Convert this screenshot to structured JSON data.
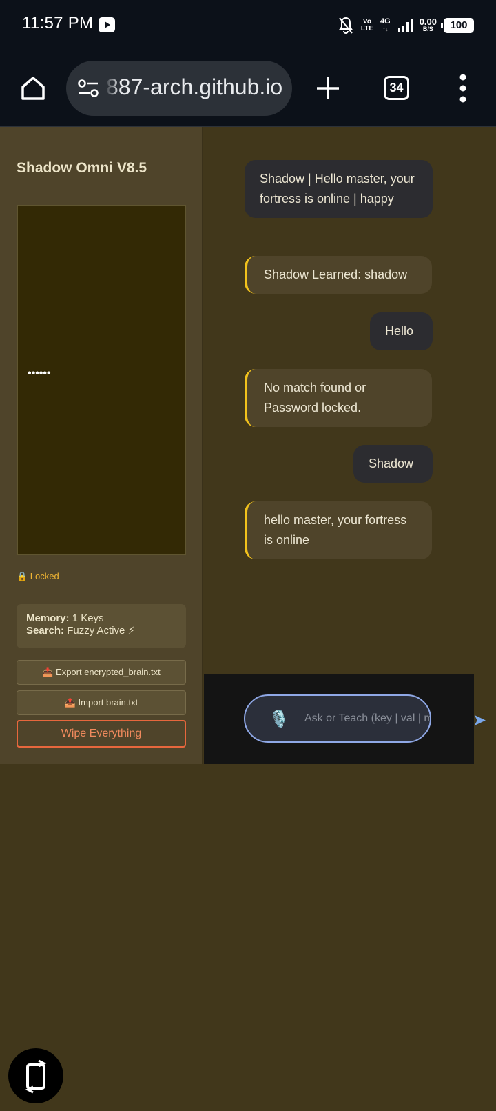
{
  "status_bar": {
    "time": "11:57 PM",
    "volte_top": "Vo",
    "volte_bottom": "LTE",
    "network": "4G",
    "network_sub": "↑↓",
    "speed": "0.00",
    "speed_unit": "B/S",
    "battery": "100"
  },
  "browser": {
    "url": "887-arch.github.io",
    "tab_count": "34"
  },
  "sidebar": {
    "title": "Shadow Omni V8.5",
    "password_dots": "••••••",
    "lock_status": "🔒 Locked",
    "memory_label": "Memory:",
    "memory_value": " 1 Keys",
    "search_label": "Search:",
    "search_value": " Fuzzy Active ⚡",
    "export_label": "📥 Export encrypted_brain.txt",
    "import_label": "📤 Import brain.txt",
    "wipe_label": "Wipe Everything"
  },
  "chat": {
    "messages": [
      {
        "type": "bot",
        "text": "Shadow | Hello master, your fortress is online | happy"
      },
      {
        "type": "note",
        "text": "Shadow Learned: shadow"
      },
      {
        "type": "user",
        "text": "Hello"
      },
      {
        "type": "note",
        "text": "No match found or Password locked."
      },
      {
        "type": "user",
        "text": "Shadow"
      },
      {
        "type": "note",
        "text": "hello master, your fortress is online"
      }
    ]
  },
  "input": {
    "mic_icon": "🎙️",
    "placeholder": "Ask or Teach (key | val | mood)...",
    "send_icon": "➤"
  },
  "icons": {
    "home": "home-icon",
    "tune": "site-settings-icon",
    "plus": "new-tab-icon",
    "menu": "more-vert-icon",
    "fab": "rotate-icon"
  },
  "colors": {
    "page_bg": "#41371b",
    "sidebar_bg": "#4f442a",
    "accent_yellow": "#f2c21c",
    "danger": "#e7673d",
    "input_border": "#8fa8e6"
  }
}
